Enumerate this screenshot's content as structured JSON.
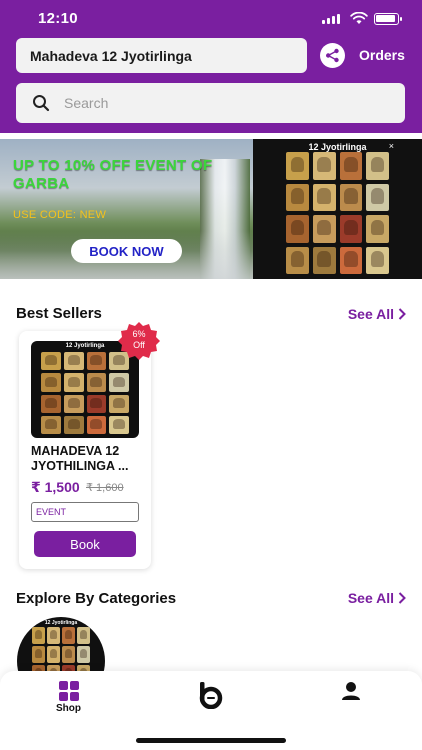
{
  "status_bar": {
    "time": "12:10"
  },
  "header": {
    "title": "Mahadeva 12 Jyotirlinga",
    "orders_label": "Orders",
    "share_icon": "share-icon"
  },
  "search": {
    "placeholder": "Search"
  },
  "banner": {
    "headline": "UP TO 10% OFF EVENT OF GARBA",
    "code_text": "USE CODE: NEW",
    "cta_label": "BOOK NOW",
    "poster_title": "12 Jyotirlinga",
    "poster_close": "×"
  },
  "best_sellers": {
    "title": "Best Sellers",
    "see_all": "See All",
    "products": [
      {
        "image_title": "12 Jyotirlinga",
        "discount": "6%",
        "discount_suffix": "Off",
        "name": "MAHADEVA 12 JYOTHILINGA ...",
        "price": "₹ 1,500",
        "mrp": "₹ 1,600",
        "tag": "EVENT",
        "cta": "Book"
      }
    ]
  },
  "categories": {
    "title": "Explore By Categories",
    "see_all": "See All",
    "image_title": "12 Jyotirlinga"
  },
  "tabbar": {
    "tabs": [
      {
        "label": "Shop",
        "icon": "grid-icon",
        "active": true
      },
      {
        "label": "",
        "icon": "brand-logo-icon",
        "active": false
      },
      {
        "label": "",
        "icon": "profile-icon",
        "active": false
      }
    ]
  },
  "colors": {
    "brand": "#7a1fa0",
    "promo_green": "#3bd63b",
    "promo_code": "#f6c21b",
    "badge": "#e02b4a"
  }
}
